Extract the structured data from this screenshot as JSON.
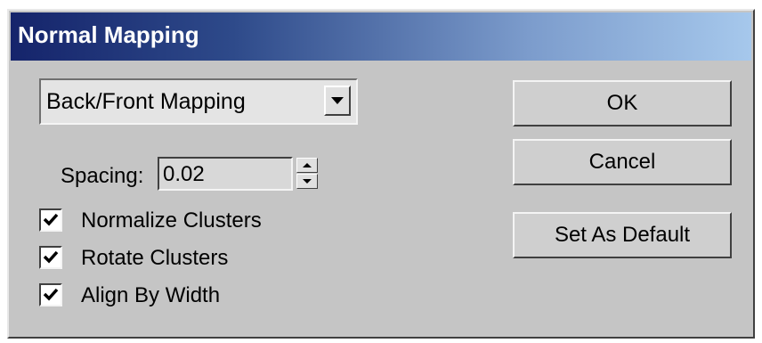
{
  "window": {
    "title": "Normal Mapping"
  },
  "mapping": {
    "selected": "Back/Front Mapping"
  },
  "spacing": {
    "label": "Spacing:",
    "value": "0.02"
  },
  "options": [
    {
      "label": "Normalize Clusters",
      "checked": true
    },
    {
      "label": "Rotate Clusters",
      "checked": true
    },
    {
      "label": "Align By Width",
      "checked": true
    }
  ],
  "buttons": {
    "ok": "OK",
    "cancel": "Cancel",
    "set_default": "Set As Default"
  },
  "icons": {
    "dropdown": "chevron-down-icon",
    "spin_up": "arrow-up-icon",
    "spin_down": "arrow-down-icon",
    "check": "checkmark-icon"
  }
}
